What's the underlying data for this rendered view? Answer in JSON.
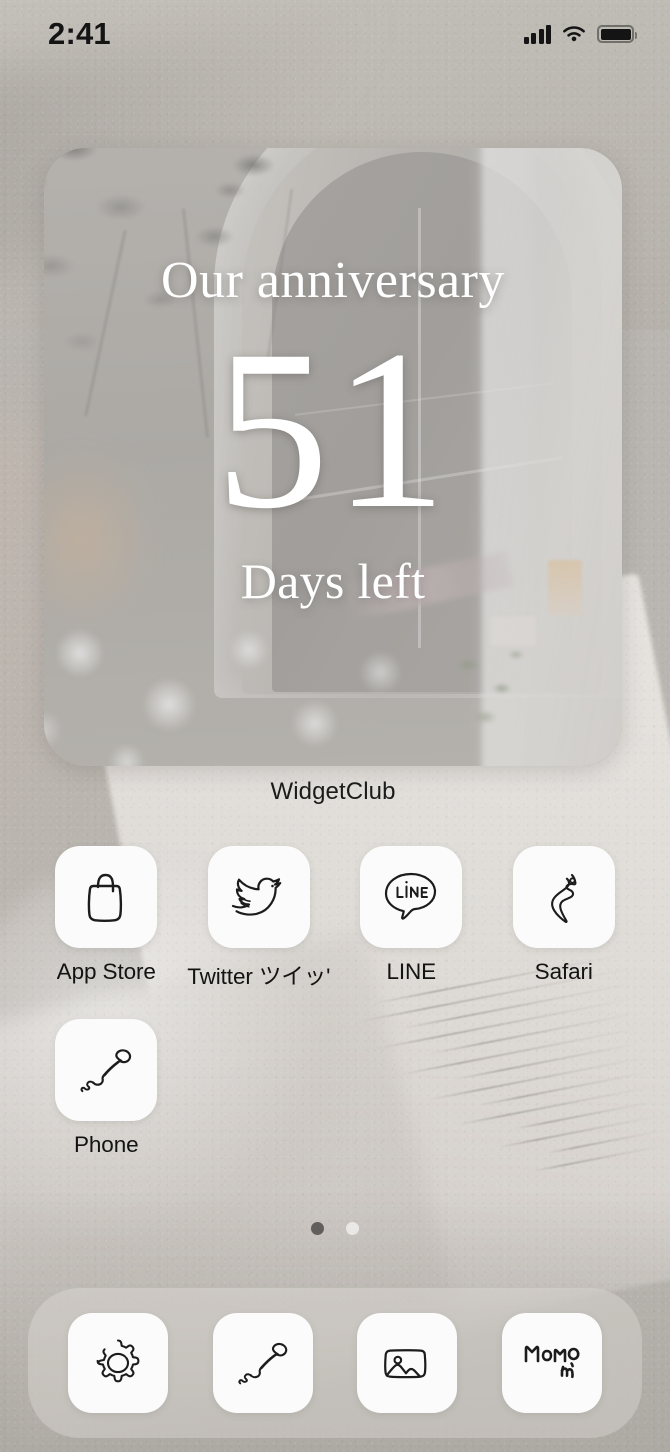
{
  "status_bar": {
    "time": "2:41",
    "signal_icon": "cellular-signal-icon",
    "wifi_icon": "wifi-icon",
    "battery_icon": "battery-full-icon"
  },
  "widget": {
    "title": "Our anniversary",
    "count": "51",
    "subtitle": "Days left",
    "app_label": "WidgetClub"
  },
  "home_screen": {
    "apps": [
      {
        "label": "App Store",
        "icon": "shopping-bag-icon"
      },
      {
        "label": "Twitter ツイッ'",
        "icon": "twitter-bird-icon"
      },
      {
        "label": "LINE",
        "icon": "line-speech-bubble-icon"
      },
      {
        "label": "Safari",
        "icon": "compass-needle-icon"
      },
      {
        "label": "Phone",
        "icon": "phone-handset-icon"
      }
    ]
  },
  "page_indicator": {
    "pages": 2,
    "current": 1
  },
  "dock": {
    "items": [
      {
        "label": "Settings",
        "icon": "gear-icon"
      },
      {
        "label": "Phone",
        "icon": "phone-handset-icon"
      },
      {
        "label": "Photos",
        "icon": "photo-frame-icon"
      },
      {
        "label": "Memo",
        "icon": "memo-handwriting-icon"
      }
    ]
  },
  "colors": {
    "wallpaper": "#b9b5b0",
    "icon_tile": "#fbfbfb",
    "ink": "#1b1b1b",
    "widget_text": "#ffffff",
    "dock_tint": "rgba(238,236,233,0.30)"
  }
}
